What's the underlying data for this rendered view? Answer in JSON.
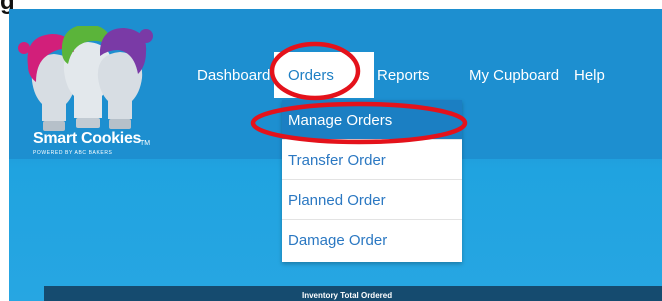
{
  "top_clip_letter": "g",
  "logo": {
    "name": "Smart Cookies",
    "tm": "TM",
    "tagline": "POWERED BY ABC BAKERS"
  },
  "nav": {
    "dashboard": "Dashboard",
    "orders": "Orders",
    "reports": "Reports",
    "my_cupboard": "My Cupboard",
    "help": "Help"
  },
  "dropdown": {
    "items": [
      "Manage Orders",
      "Transfer Order",
      "Planned Order",
      "Damage Order"
    ],
    "active_index": 0
  },
  "bottom_bar": {
    "text": "Inventory Total Ordered"
  },
  "colors": {
    "header": "#1d8fd0",
    "accent": "#1b7fc3",
    "link": "#2b78c2",
    "annotation": "#e4121b",
    "bottom_bar": "#154b6f"
  }
}
